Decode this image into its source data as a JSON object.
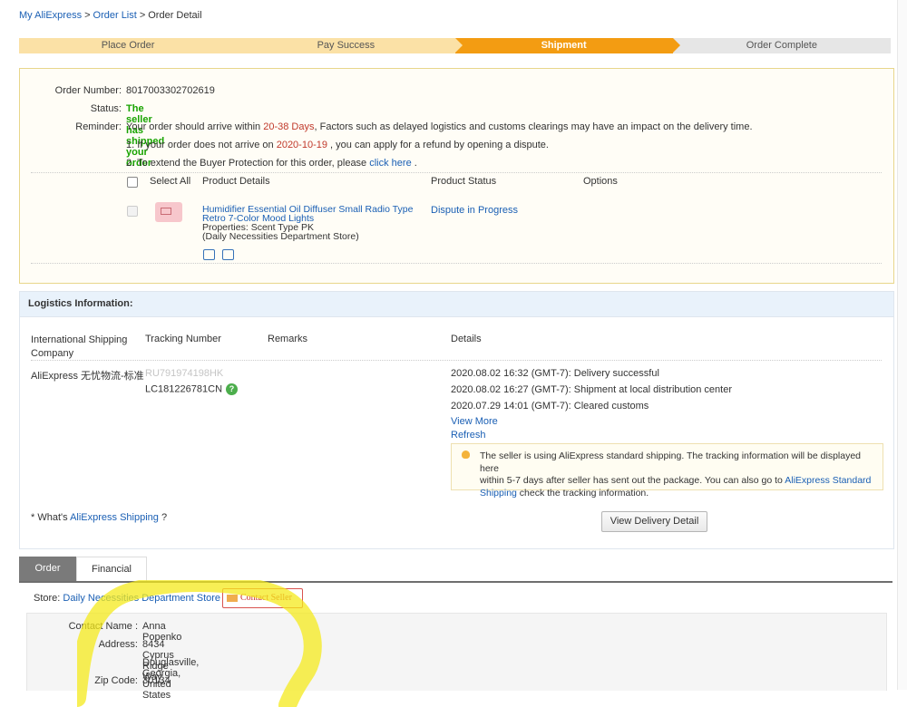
{
  "breadcrumb": {
    "home": "My AliExpress",
    "list": "Order List",
    "current": "Order Detail",
    "sep": ">"
  },
  "steps": [
    "Place Order",
    "Pay Success",
    "Shipment",
    "Order Complete"
  ],
  "order": {
    "number_label": "Order Number:",
    "number": "8017003302702619",
    "status_label": "Status:",
    "status": "The seller has shipped your order",
    "reminder_label": "Reminder:",
    "reminder_pre": "Your order should arrive within ",
    "reminder_days": "20-38 Days",
    "reminder_post": ", Factors such as delayed logistics and customs clearings may have an impact on the delivery time.",
    "note1_pre": "1. If your order does not arrive on ",
    "note1_date": "2020-10-19",
    "note1_post": " , you can apply for a refund by opening a dispute.",
    "note2_pre": "2. To extend the Buyer Protection for this order, please ",
    "note2_link": "click here",
    "note2_post": " ."
  },
  "table": {
    "select_all": "Select All",
    "product_details": "Product Details",
    "product_status": "Product Status",
    "options": "Options"
  },
  "product": {
    "title_line1": "Humidifier Essential Oil Diffuser Small Radio Type",
    "title_line2": "Retro 7-Color Mood Lights",
    "properties": "Properties: Scent Type PK",
    "store": "(Daily Necessities Department Store)",
    "status": "Dispute in Progress"
  },
  "logistics": {
    "title": "Logistics Information:",
    "col_shipping_1": "International Shipping",
    "col_shipping_2": "Company",
    "col_tracking": "Tracking Number",
    "col_remarks": "Remarks",
    "col_details": "Details",
    "company": "AliExpress 无忧物流-标准",
    "tracking_old": "RU791974198HK",
    "tracking_new": "LC181226781CN",
    "events": [
      "2020.08.02 16:32 (GMT-7): Delivery successful",
      "2020.08.02 16:27 (GMT-7): Shipment at local distribution center",
      "2020.07.29 14:01 (GMT-7): Cleared customs"
    ],
    "view_more": "View More",
    "refresh": "Refresh",
    "notice_line1": "The seller is using AliExpress standard shipping. The tracking information will be displayed here",
    "notice_line2_pre": "within 5-7 days after seller has sent out the package. You can also go to ",
    "notice_link1": "AliExpress Standard",
    "notice_link2": "Shipping",
    "notice_post": " check the tracking information.",
    "whats_pre": "* What's ",
    "whats_link": "AliExpress Shipping",
    "whats_post": " ?",
    "view_delivery": "View Delivery Detail"
  },
  "tabs": {
    "order": "Order",
    "financial": "Financial"
  },
  "store": {
    "label": "Store:",
    "name": "Daily Necessities Department Store",
    "contact": "Contact Seller"
  },
  "address": {
    "contact_label": "Contact Name :",
    "contact": "Anna Popenko",
    "address_label": "Address:",
    "line1": "8434 Cyprus Ridge Way",
    "line2": "Douglasville, Georgia, United States",
    "zip_label": "Zip Code:",
    "zip": "30134"
  },
  "colors": {
    "accent": "#f39c12",
    "link": "#1a5fb4",
    "status": "#18a300",
    "highlight": "#f4ea1c"
  }
}
